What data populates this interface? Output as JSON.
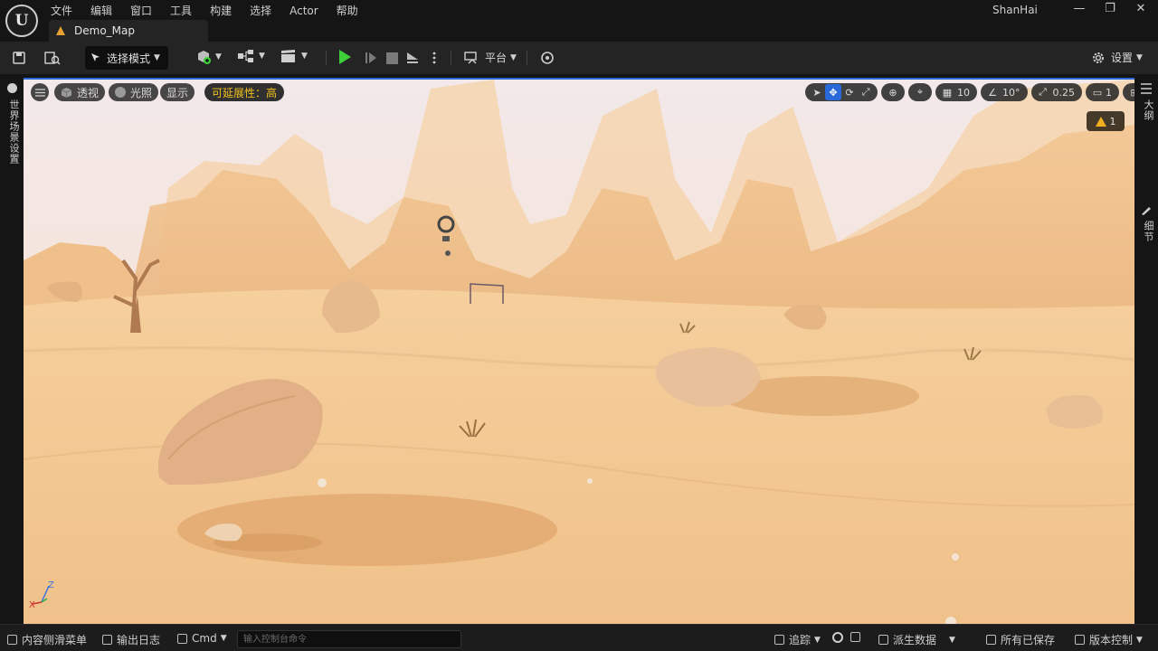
{
  "app": {
    "logo_text": "U",
    "user": "ShanHai",
    "menus": [
      "文件",
      "编辑",
      "窗口",
      "工具",
      "构建",
      "选择",
      "Actor",
      "帮助"
    ],
    "tab_title": "Demo_Map",
    "window_controls": [
      "—",
      "❐",
      "✕"
    ]
  },
  "toolbar": {
    "mode_label": "选择模式",
    "platform_label": "平台",
    "settings_label": "设置"
  },
  "sidebars": {
    "left_label": "世界场景设置",
    "right_top_label": "大纲",
    "right_bottom_label": "细节"
  },
  "viewport": {
    "perspective_label": "透视",
    "lighting_label": "光照",
    "show_label": "显示",
    "scalability_label": "可延展性：高",
    "grid_snap": "10",
    "rotation_snap": "10°",
    "scale_snap": "0.25",
    "camera_speed": "1",
    "warning_count": "1",
    "axis": {
      "z": "Z",
      "x": "X"
    }
  },
  "statusbar": {
    "content_drawer": "内容侧滑菜单",
    "output_log": "输出日志",
    "cmd_label": "Cmd",
    "console_placeholder": "输入控制台命令",
    "trace_label": "追踪",
    "derived_data": "派生数据",
    "all_saved": "所有已保存",
    "source_control": "版本控制"
  },
  "colors": {
    "accent_blue": "#2a6ad8",
    "play_green": "#3fcf3a",
    "warning_yellow": "#f0b020",
    "scalability_text": "#f0c020"
  }
}
